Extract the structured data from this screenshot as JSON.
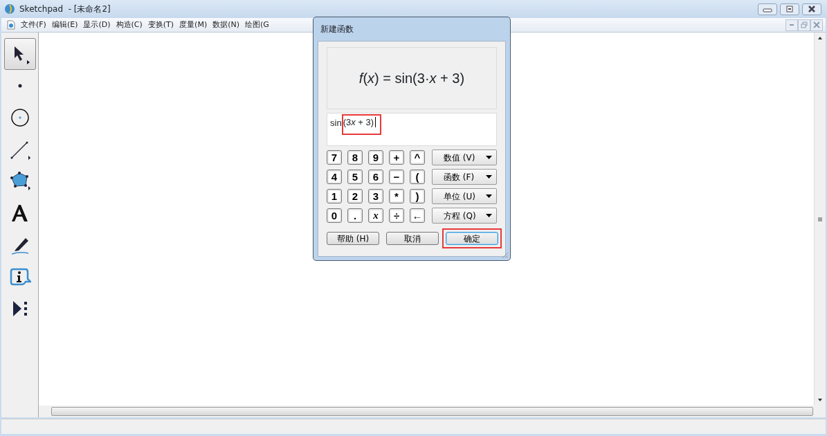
{
  "window": {
    "title": "Sketchpad  - [未命名2]"
  },
  "menu": [
    "文件(F)",
    "编辑(E)",
    "显示(D)",
    "构造(C)",
    "变换(T)",
    "度量(M)",
    "数据(N)",
    "绘图(G"
  ],
  "toolbox": [
    {
      "kind": "arrow",
      "selected": true
    },
    {
      "kind": "point",
      "selected": false
    },
    {
      "kind": "compass",
      "selected": false
    },
    {
      "kind": "line",
      "selected": false
    },
    {
      "kind": "polygon",
      "selected": false
    },
    {
      "kind": "text",
      "selected": false
    },
    {
      "kind": "marker",
      "selected": false
    },
    {
      "kind": "info",
      "selected": false
    },
    {
      "kind": "custom",
      "selected": false
    }
  ],
  "dialog": {
    "title": "新建函数",
    "preview": "*f*(*x*) = sin(3·*x* + 3)",
    "expression": [
      {
        "text": "sin",
        "italic": false,
        "highlighted": false
      },
      {
        "text": "(3",
        "italic": false,
        "highlighted": true
      },
      {
        "text": "x",
        "italic": true,
        "highlighted": true
      },
      {
        "text": " + 3)",
        "italic": false,
        "highlighted": true
      }
    ],
    "keys": [
      [
        {
          "label": "7"
        },
        {
          "label": "8"
        },
        {
          "label": "9"
        },
        {
          "label": "+"
        },
        {
          "label": "^"
        }
      ],
      [
        {
          "label": "4"
        },
        {
          "label": "5"
        },
        {
          "label": "6"
        },
        {
          "label": "−"
        },
        {
          "label": "("
        }
      ],
      [
        {
          "label": "1"
        },
        {
          "label": "2"
        },
        {
          "label": "3"
        },
        {
          "label": "*"
        },
        {
          "label": ")"
        }
      ],
      [
        {
          "label": "0"
        },
        {
          "label": "."
        },
        {
          "label": "x",
          "kind": "variable"
        },
        {
          "label": "÷"
        },
        {
          "label": "←",
          "kind": "arrow"
        }
      ]
    ],
    "menus": [
      "数值 (V)",
      "函数 (F)",
      "单位 (U)",
      "方程 (Q)"
    ],
    "buttons": [
      {
        "label": "帮助 (H)",
        "default": false,
        "highlighted": false
      },
      {
        "label": "取消",
        "default": false,
        "highlighted": false
      },
      {
        "label": "确定",
        "default": true,
        "highlighted": true
      }
    ]
  }
}
